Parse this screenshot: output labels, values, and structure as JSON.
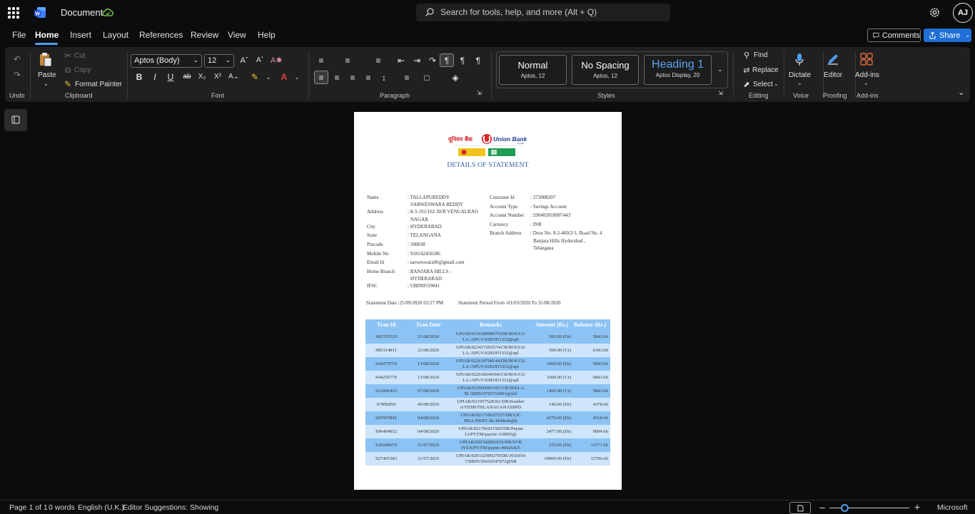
{
  "titlebar": {
    "doc_title": "Document",
    "search_placeholder": "Search for tools, help, and more (Alt + Q)",
    "avatar_initials": "AJ"
  },
  "menu": {
    "tabs": [
      "File",
      "Home",
      "Insert",
      "Layout",
      "References",
      "Review",
      "View",
      "Help"
    ],
    "comments_label": "Comments",
    "share_label": "Share"
  },
  "ribbon": {
    "undo_label": "Undo",
    "clipboard": {
      "paste": "Paste",
      "cut": "Cut",
      "copy": "Copy",
      "format_painter": "Format Painter",
      "label": "Clipboard"
    },
    "font": {
      "name": "Aptos (Body)",
      "size": "12",
      "label": "Font"
    },
    "paragraph_label": "Paragraph",
    "styles": [
      {
        "name": "Normal",
        "sub": "Aptos, 12"
      },
      {
        "name": "No Spacing",
        "sub": "Aptos, 12"
      },
      {
        "name": "Heading 1",
        "sub": "Aptos Display, 20"
      }
    ],
    "styles_label": "Styles",
    "editing": {
      "find": "Find",
      "replace": "Replace",
      "select": "Select",
      "label": "Editing"
    },
    "voice": {
      "dictate": "Dictate",
      "label": "Voice"
    },
    "proofing": {
      "editor": "Editor",
      "label": "Proofing"
    },
    "addins": {
      "addins": "Add-ins",
      "label": "Add-ins"
    }
  },
  "document": {
    "logo_text": "यूनियन बैंक Union Bank",
    "heading": "DETAILS OF STATEMENT",
    "left_fields": [
      {
        "label": "Name",
        "value": ": TALLAPUREDDY"
      },
      {
        "label": "",
        "value": "SARWESWARA REDDY"
      },
      {
        "label": "Address",
        "value": ": 8-3-191/162 30/B VENGALRAO"
      },
      {
        "label": "",
        "value": "NAGAR"
      },
      {
        "label": "City",
        "value": ": HYDERABAD"
      },
      {
        "label": "State",
        "value": ": TELANGANA"
      },
      {
        "label": "Pincode",
        "value": ": 500038"
      },
      {
        "label": "Mobile No",
        "value": ": 918142456586"
      },
      {
        "label": "Email Id",
        "value": ": sarweswara06@gmail.com"
      },
      {
        "label": "Home Branch",
        "value": ": BANJARA HILLS -"
      },
      {
        "label": "",
        "value": "HYDERABAD"
      },
      {
        "label": "IFSC",
        "value": ": UBIN0559041"
      }
    ],
    "right_fields": [
      {
        "label": "Customer Id",
        "value": ": 272008207"
      },
      {
        "label": "Account Type",
        "value": ": Savings Account"
      },
      {
        "label": "Account Number",
        "value": ": 590402010007443"
      },
      {
        "label": "Currency",
        "value": ": INR"
      },
      {
        "label": "Branch Address",
        "value": ": Door No. 8-2-460/2/1, Road No. 4"
      },
      {
        "label": "",
        "value": "Banjara Hills Hyderabad ,"
      },
      {
        "label": "",
        "value": "Telangana"
      }
    ],
    "statement_date": "Statement Date :25/09/2020 03:27 PM",
    "statement_period": "Statement Period From -01/03/2020 To 31/08/2020",
    "table_headers": [
      "Tran Id",
      "Tran Date",
      "Remarks",
      "Amount (Rs.)",
      "Balance (Rs.)"
    ],
    "transactions": [
      {
        "id": "S85355520",
        "date": "21/08/2020",
        "remarks1": "UPIAR/023418999079/DR/BOGGU",
        "remarks2": "LA /APGV/6281951332@apl",
        "amount": "500.00 (Dr)",
        "balance": "5843.66"
      },
      {
        "id": "S85314811",
        "date": "21/08/2020",
        "remarks1": "UPIAB/023417293574/CR/BOGGU",
        "remarks2": "LA /APGV/6281951332@apl",
        "amount": "500.00 (Cr)",
        "balance": "6343.66"
      },
      {
        "id": "S44279759",
        "date": "13/08/2020",
        "remarks1": "UPIAR/022618708144/DR/BOGGU",
        "remarks2": "LA /APGV/6281951332@apl",
        "amount": "1000.00 (Dr)",
        "balance": "5843.66"
      },
      {
        "id": "S44256770",
        "date": "13/08/2020",
        "remarks1": "UPIAB/022618649366/CR/BOGGU",
        "remarks2": "LA /APGV/6281951332@apl",
        "amount": "1000.00 (Cr)",
        "balance": "6843.66"
      },
      {
        "id": "S12006425",
        "date": "07/08/2020",
        "remarks1": "UPIAB/022045001167/CR/SEELA",
        "remarks2": "M /SBIN/9705764991@ybl",
        "amount": "1465.00 (Cr)",
        "balance": "5843.66"
      },
      {
        "id": "S7856859",
        "date": "06/08/2020",
        "remarks1": "UPIAR/021957528361/DR/Souther",
        "remarks2": "n/YESB/TELANAGANASSPD",
        "amount": "140.00 (Dr)",
        "balance": "4378.66"
      },
      {
        "id": "S97097845",
        "date": "04/08/2020",
        "remarks1": "UPIAR/021718637237/DR/LIC",
        "remarks2": "BILL/HDFC/lic.billdesk@h",
        "amount": "4576.00 (Dr)",
        "balance": "4518.66"
      },
      {
        "id": "S96404932",
        "date": "04/08/2020",
        "remarks1": "UPIAR/021706011583/DR/Paytm",
        "remarks2": "LI/PYTM/paytm-318993@",
        "amount": "2477.00 (Dr)",
        "balance": "9094.66"
      },
      {
        "id": "S30180679",
        "date": "21/07/2020",
        "remarks1": "UPIAR/020342801810/DR/SVB",
        "remarks2": "IYEN/PYTM/paytm-40026425",
        "amount": "225.00 (Dr)",
        "balance": "11571.66"
      },
      {
        "id": "S27465383",
        "date": "21/07/2020",
        "remarks1": "UPIAR/020332909279/DR/3016954",
        "remarks2": "7/SBIN/30169547072@SB",
        "amount": "10000.00 (Dr)",
        "balance": "11796.66"
      }
    ]
  },
  "statusbar": {
    "page": "Page 1 of 1",
    "words": "0 words",
    "language": "English (U.K.)",
    "editor": "Editor Suggestions: Showing",
    "brand": "Microsoft"
  }
}
